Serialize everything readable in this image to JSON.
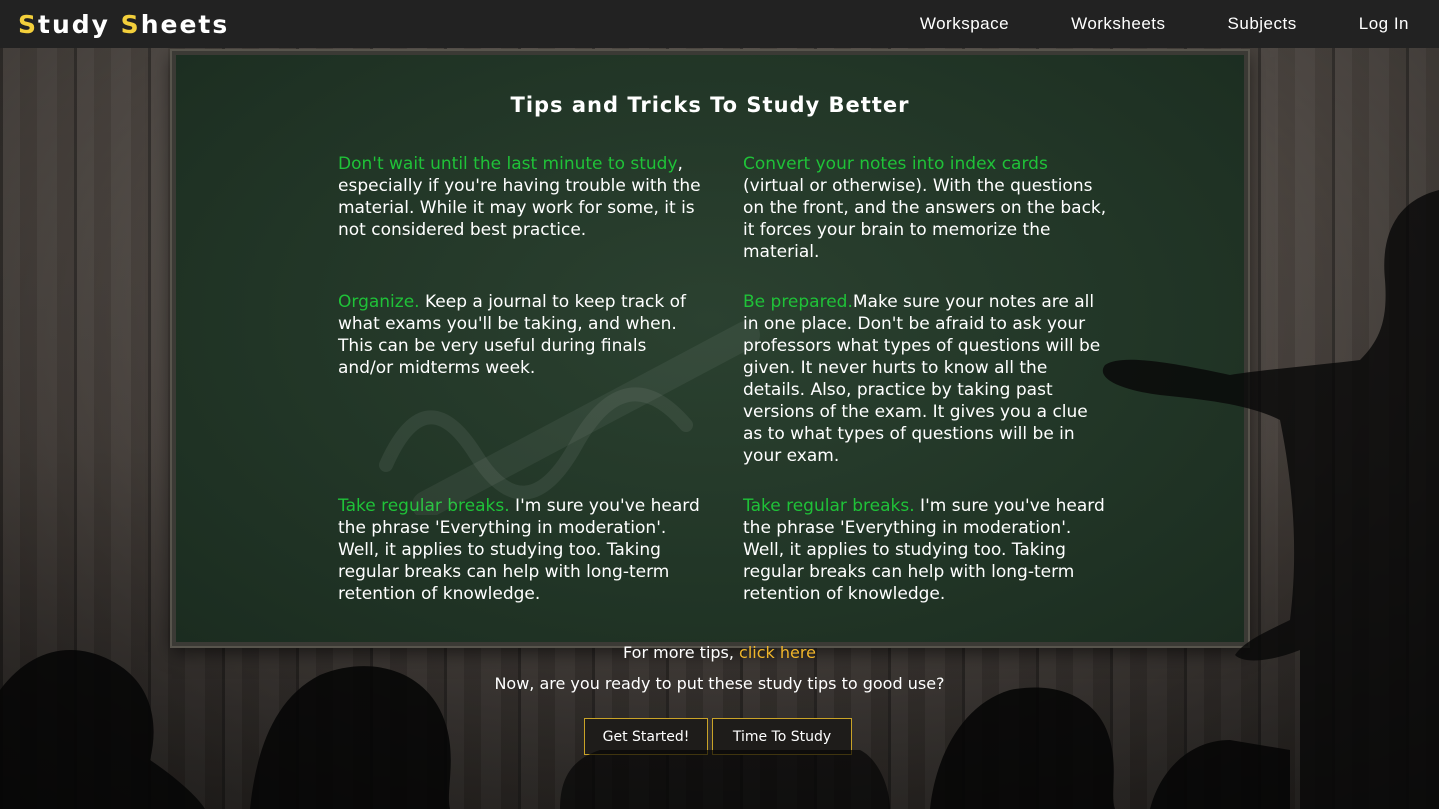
{
  "app": {
    "brand_first": "S",
    "brand_rest1": "tudy ",
    "brand_second": "S",
    "brand_rest2": "heets"
  },
  "nav": {
    "items": [
      {
        "label": "Workspace"
      },
      {
        "label": "Worksheets"
      },
      {
        "label": "Subjects"
      },
      {
        "label": "Log In"
      }
    ]
  },
  "board": {
    "heading": "Tips and Tricks To Study Better",
    "tips": [
      {
        "lead": "Don't wait until the last minute to study",
        "body": ", especially if you're having trouble with the material. While it may work for some, it is not considered best practice."
      },
      {
        "lead": "Convert your notes into index cards",
        "body": " (virtual or otherwise). With the questions on the front, and the answers on the back, it forces your brain to memorize the material."
      },
      {
        "lead": "Organize.",
        "body": " Keep a journal to keep track of what exams you'll be taking, and when. This can be very useful during finals and/or midterms week."
      },
      {
        "lead": "Be prepared.",
        "body": "Make sure your notes are all in one place. Don't be afraid to ask your professors what types of questions will be given. It never hurts to know all the details. Also, practice by taking past versions of the exam. It gives you a clue as to what types of questions will be in your exam."
      },
      {
        "lead": "Take regular breaks.",
        "body": " I'm sure you've heard the phrase 'Everything in moderation'. Well, it applies to studying too. Taking regular breaks can help with long-term retention of knowledge."
      },
      {
        "lead": "Take regular breaks.",
        "body": " I'm sure you've heard the phrase 'Everything in moderation'. Well, it applies to studying too. Taking regular breaks can help with long-term retention of knowledge."
      }
    ]
  },
  "footer": {
    "more_prefix": "For more tips, ",
    "more_link": "click here",
    "ready": "Now, are you ready to put these study tips to good use?",
    "get_started": "Get Started!",
    "time_to_study": "Time To Study"
  },
  "colors": {
    "accent_yellow": "#f3cf3b",
    "tip_green": "#1fc238",
    "link_orange": "#f0b52a",
    "button_border": "#c9a327"
  }
}
